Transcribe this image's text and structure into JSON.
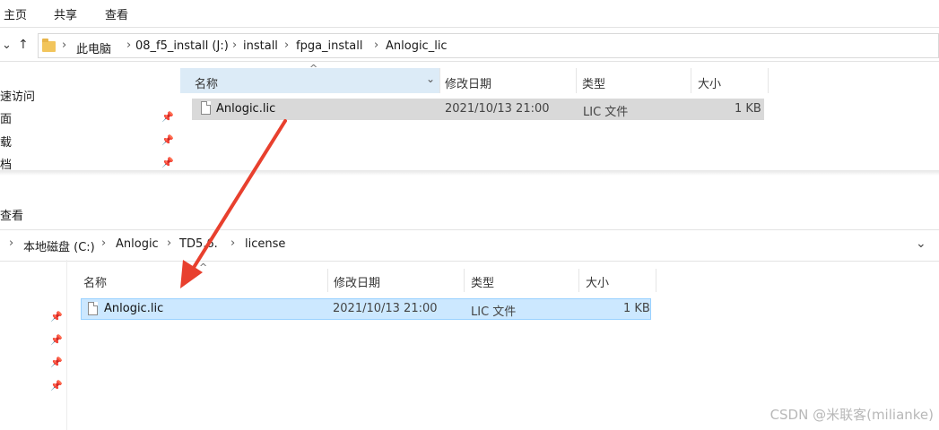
{
  "top": {
    "ribbon_tabs": [
      "主页",
      "共享",
      "查看"
    ],
    "breadcrumb": [
      "此电脑",
      "08_f5_install (J:)",
      "install",
      "fpga_install",
      "Anlogic_lic"
    ],
    "sidebar": [
      "速访问",
      "面",
      "载",
      "档"
    ],
    "columns": {
      "name": "名称",
      "modified": "修改日期",
      "type": "类型",
      "size": "大小"
    },
    "file": {
      "name": "Anlogic.lic",
      "modified": "2021/10/13 21:00",
      "type": "LIC 文件",
      "size": "1 KB"
    }
  },
  "bottom": {
    "ribbon_tab": "查看",
    "breadcrumb": [
      "本地磁盘 (C:)",
      "Anlogic",
      "TD5.6.",
      "license"
    ],
    "columns": {
      "name": "名称",
      "modified": "修改日期",
      "type": "类型",
      "size": "大小"
    },
    "file": {
      "name": "Anlogic.lic",
      "modified": "2021/10/13 21:00",
      "type": "LIC 文件",
      "size": "1 KB"
    }
  },
  "colors": {
    "arrow": "#e8402e",
    "header_blue": "#dcebf7",
    "selected_row": "#cce8ff",
    "grey_row": "#d9d9d9"
  },
  "icons": [
    "folder-icon",
    "file-icon",
    "pin-icon",
    "up-arrow-icon",
    "chevron-down-icon",
    "red-arrow"
  ],
  "watermark": "CSDN @米联客(milianke)"
}
